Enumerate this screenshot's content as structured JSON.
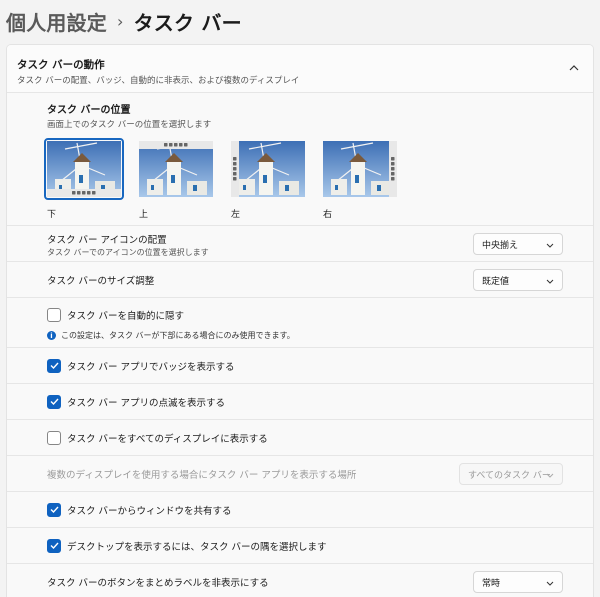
{
  "breadcrumb": {
    "parent": "個人用設定",
    "separator": "›",
    "current": "タスク バー"
  },
  "section": {
    "title": "タスク バーの動作",
    "description": "タスク バーの配置、バッジ、自動的に非表示、および複数のディスプレイ"
  },
  "position": {
    "title": "タスク バーの位置",
    "description": "画面上でのタスク バーの位置を選択します",
    "options": [
      {
        "label": "下",
        "selected": true
      },
      {
        "label": "上",
        "selected": false
      },
      {
        "label": "左",
        "selected": false
      },
      {
        "label": "右",
        "selected": false
      }
    ]
  },
  "alignment": {
    "title": "タスク バー アイコンの配置",
    "description": "タスク バーでのアイコンの位置を選択します",
    "value": "中央揃え"
  },
  "size": {
    "label": "タスク バーのサイズ調整",
    "value": "既定値"
  },
  "autohide": {
    "label": "タスク バーを自動的に隠す",
    "checked": false,
    "note": "この設定は、タスク バーが下部にある場合にのみ使用できます。"
  },
  "badges": {
    "label": "タスク バー アプリでバッジを表示する",
    "checked": true
  },
  "flashing": {
    "label": "タスク バー アプリの点滅を表示する",
    "checked": true
  },
  "all_displays": {
    "label": "タスク バーをすべてのディスプレイに表示する",
    "checked": false
  },
  "multi_display": {
    "label": "複数のディスプレイを使用する場合にタスク バー アプリを表示する場所",
    "value": "すべてのタスク バー"
  },
  "share_window": {
    "label": "タスク バーからウィンドウを共有する",
    "checked": true
  },
  "show_desktop": {
    "label": "デスクトップを表示するには、タスク バーの隅を選択します",
    "checked": true
  },
  "combine": {
    "label": "タスク バーのボタンをまとめラベルを非表示にする",
    "value": "常時"
  },
  "colors": {
    "accent": "#0f62c0",
    "background": "#f3f3f3",
    "panel": "#f9f9f9"
  }
}
